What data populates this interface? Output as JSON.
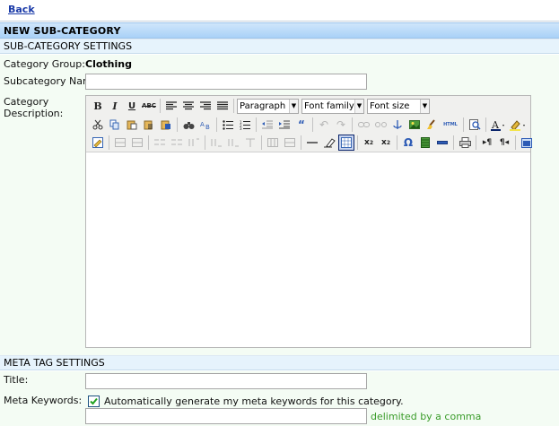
{
  "top": {
    "back_label": "Back"
  },
  "header": {
    "title": "NEW SUB-CATEGORY"
  },
  "subcategory_section": {
    "title": "SUB-CATEGORY SETTINGS",
    "category_group_label": "Category Group:",
    "category_group_value": "Clothing",
    "subcategory_name_label": "Subcategory Name:",
    "subcategory_name_value": "",
    "category_description_label": "Category Description:"
  },
  "editor": {
    "format_select": "Paragraph",
    "font_family_select": "Font family",
    "font_size_select": "Font size",
    "content": ""
  },
  "meta_section": {
    "title": "META TAG SETTINGS",
    "title_label": "Title:",
    "title_value": "",
    "keywords_label": "Meta Keywords:",
    "auto_generate_label": "Automatically generate my meta keywords for this category.",
    "auto_generate_checked": true,
    "keywords_value": "",
    "keywords_hint": "delimited by a comma"
  },
  "colors": {
    "header_bar": "#a9d1f7",
    "section_bar": "#e6f3fc",
    "form_background": "#f4fcf4",
    "link": "#1a3aa8",
    "hint_green": "#3a9c2a"
  }
}
